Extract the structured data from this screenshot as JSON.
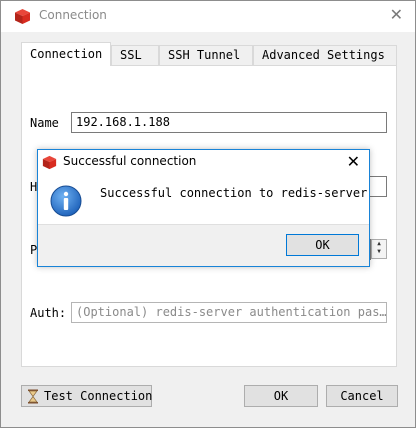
{
  "window": {
    "title": "Connection",
    "close_glyph": "✕",
    "icon": "redis-cube-icon"
  },
  "tabs": [
    {
      "label": "Connection",
      "active": true
    },
    {
      "label": "SSL",
      "active": false
    },
    {
      "label": "SSH Tunnel",
      "active": false
    },
    {
      "label": "Advanced Settings",
      "active": false
    }
  ],
  "form": {
    "name_label": "Name",
    "name_value": "192.168.1.188",
    "host_label_partial": "H",
    "port_label_partial": "P",
    "auth_label": "Auth:",
    "auth_placeholder": "(Optional) redis-server authentication pas…"
  },
  "buttons": {
    "test_connection": "Test Connection",
    "ok": "OK",
    "cancel": "Cancel"
  },
  "dialog": {
    "title": "Successful connection",
    "message": "Successful connection to redis-server",
    "ok": "OK",
    "close_glyph": "✕",
    "icon": "info-icon"
  },
  "colors": {
    "accent": "#0078d7",
    "dialog_border": "#1883d7",
    "info_blue": "#2a6fc9",
    "redis_red": "#d82c20"
  }
}
